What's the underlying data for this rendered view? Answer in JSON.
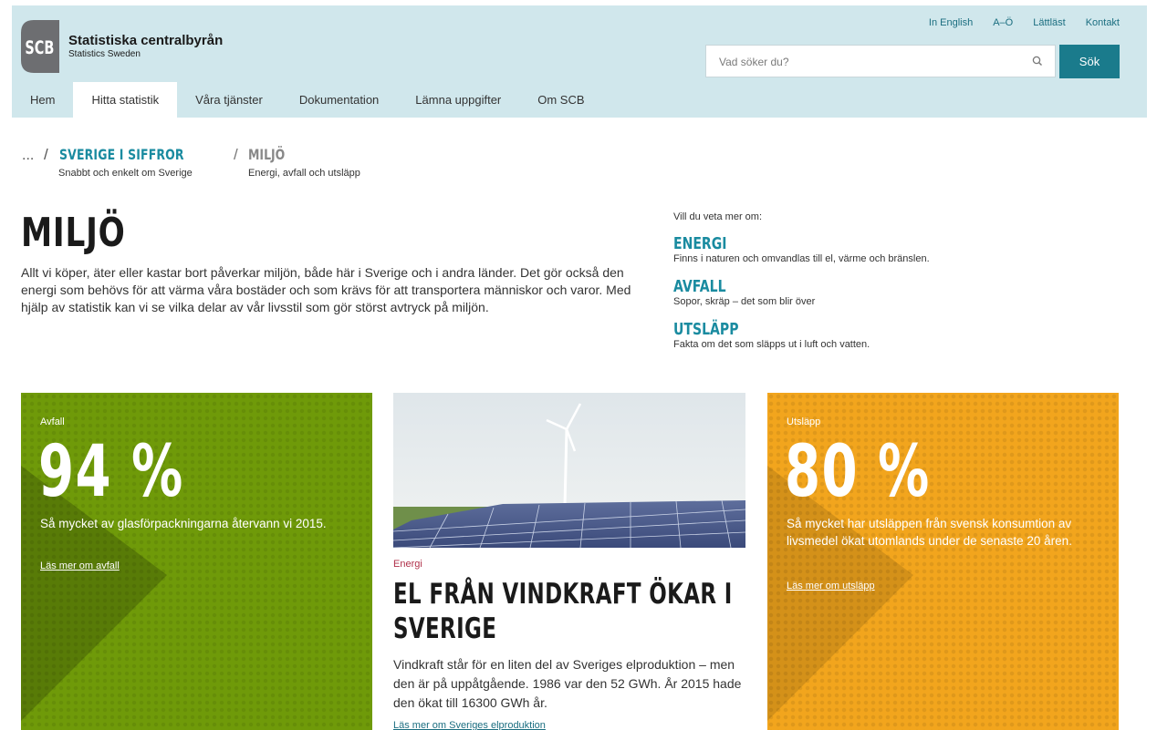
{
  "logo": {
    "mark_text": "SCB",
    "name": "Statistiska centralbyrån",
    "subtitle": "Statistics Sweden"
  },
  "top_links": [
    "In English",
    "A–Ö",
    "Lättläst",
    "Kontakt"
  ],
  "search": {
    "placeholder": "Vad söker du?",
    "button": "Sök",
    "icon": "search-icon"
  },
  "nav": {
    "items": [
      "Hem",
      "Hitta statistik",
      "Våra tjänster",
      "Dokumentation",
      "Lämna uppgifter",
      "Om SCB"
    ],
    "active": "Hitta statistik"
  },
  "breadcrumb": {
    "ellipsis": "...",
    "separator": "/",
    "items": [
      {
        "title": "SVERIGE I SIFFROR",
        "subtitle": "Snabbt och enkelt om Sverige"
      },
      {
        "title": "MILJÖ",
        "subtitle": "Energi, avfall och utsläpp"
      }
    ]
  },
  "page": {
    "title": "MILJÖ",
    "intro": "Allt vi köper, äter eller kastar bort påverkar miljön, både här i Sverige och i andra länder. Det gör också den energi som behövs för att värma våra bostäder och som krävs för att transportera människor och varor. Med hjälp av statistik kan vi se vilka delar av vår livsstil som gör störst avtryck på miljön."
  },
  "side": {
    "question": "Vill du veta mer om:",
    "items": [
      {
        "title": "ENERGI",
        "desc": "Finns i naturen och omvandlas till el, värme och bränslen."
      },
      {
        "title": "AVFALL",
        "desc": "Sopor, skräp – det som blir över"
      },
      {
        "title": "UTSLÄPP",
        "desc": "Fakta om det som släpps ut i luft och vatten."
      }
    ]
  },
  "cards": {
    "avfall": {
      "label": "Avfall",
      "big": "94 %",
      "text": "Så mycket av glasförpackningarna återvann vi 2015.",
      "link": "Läs mer om avfall",
      "color": "#6f9a09"
    },
    "energi": {
      "label": "Energi",
      "title": "EL FRÅN VINDKRAFT ÖKAR I SVERIGE",
      "text": "Vindkraft står för en liten del av Sveriges elproduktion – men den är på uppåtgående. 1986 var den 52 GWh. År 2015 hade den ökat till 16300 GWh år.",
      "link": "Läs mer om Sveriges elproduktion"
    },
    "utslapp": {
      "label": "Utsläpp",
      "big": "80 %",
      "text": "Så mycket har utsläppen från svensk konsumtion av livsmedel ökat utomlands under de senaste 20 åren.",
      "link": "Läs mer om utsläpp",
      "color": "#f2a51d"
    }
  },
  "colors": {
    "header_bg": "#d0e7ec",
    "accent": "#1a8ba0",
    "button": "#1a7b8c"
  }
}
